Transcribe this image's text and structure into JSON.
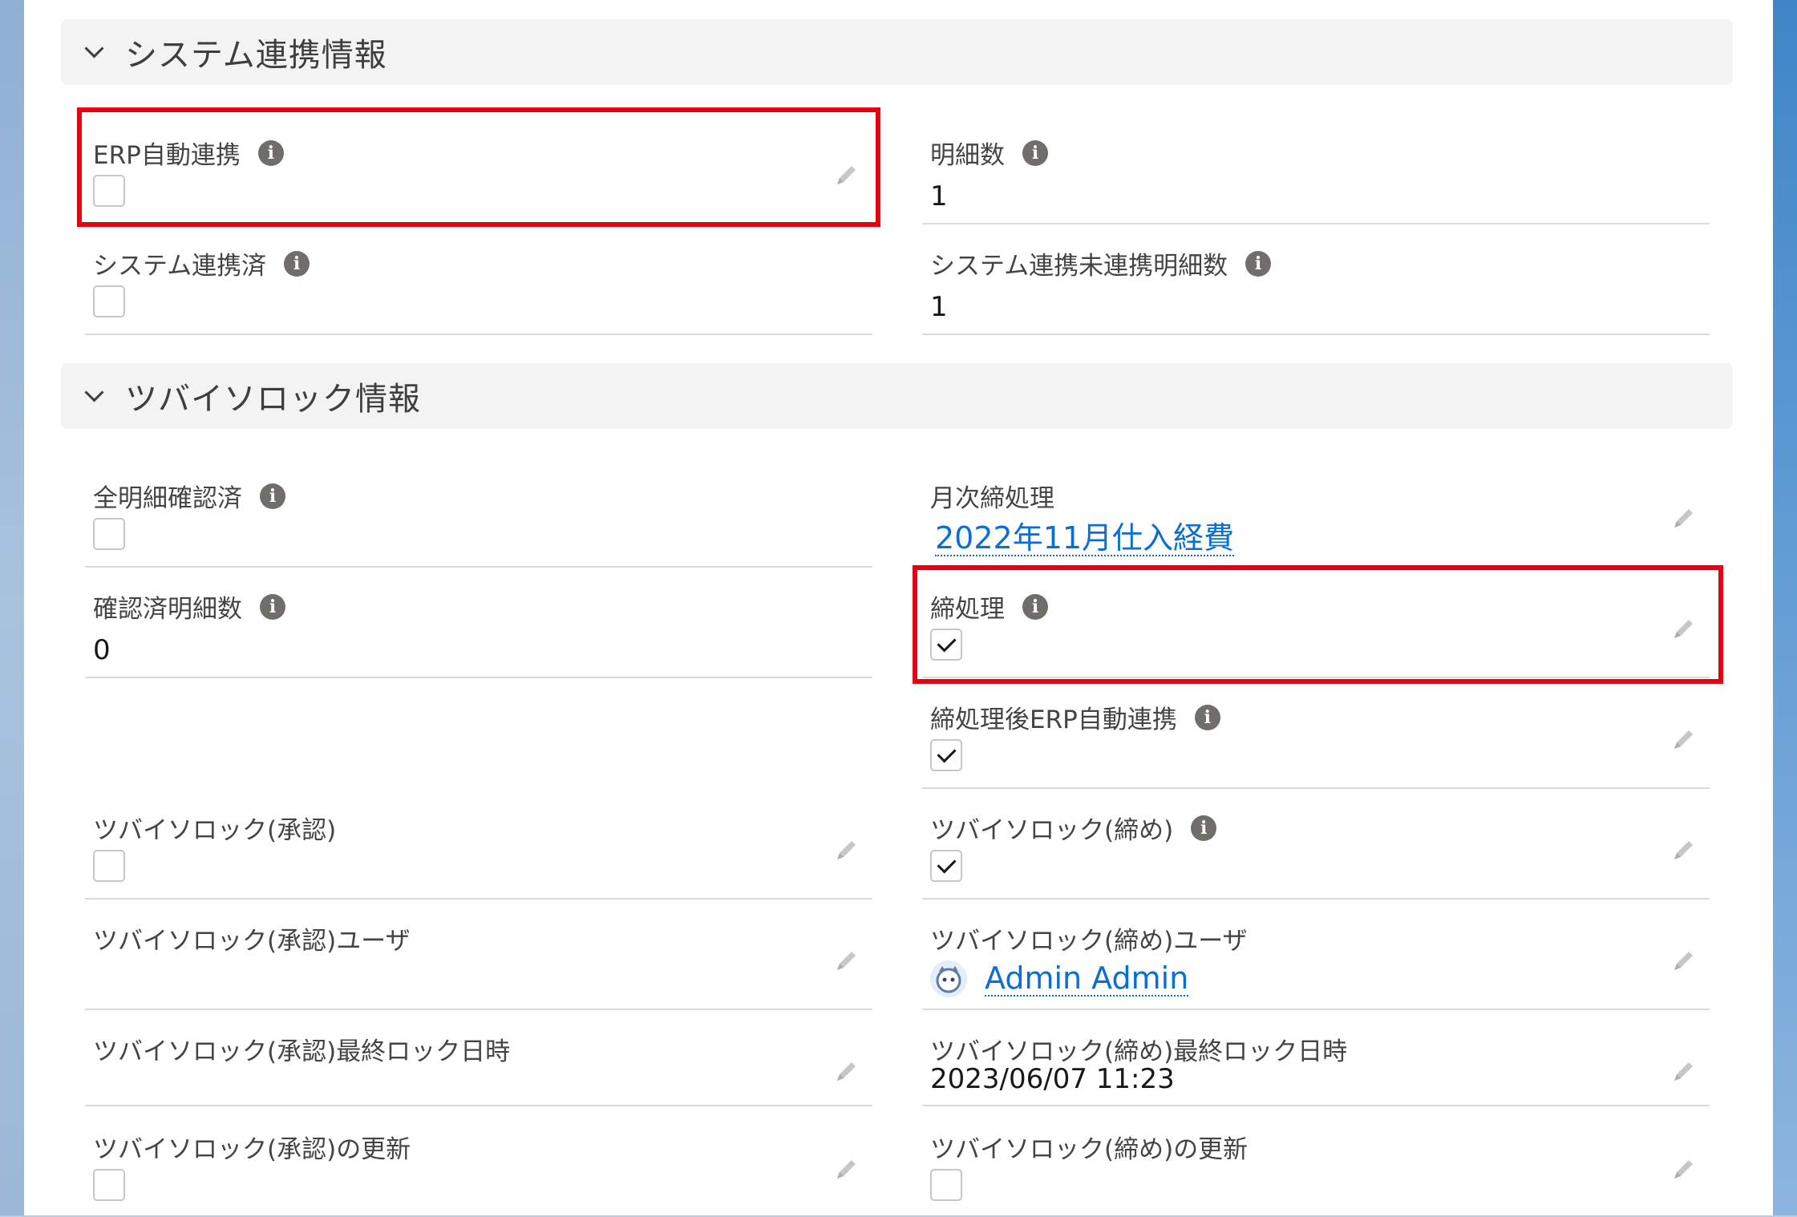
{
  "sections": {
    "system": {
      "title": "システム連携情報"
    },
    "lock": {
      "title": "ツバイソロック情報"
    }
  },
  "fields": {
    "erp_auto": {
      "label": "ERP自動連携",
      "checked": false
    },
    "line_count": {
      "label": "明細数",
      "value": "1"
    },
    "system_linked": {
      "label": "システム連携済",
      "checked": false
    },
    "unlinked_line_count": {
      "label": "システム連携未連携明細数",
      "value": "1"
    },
    "all_lines_confirmed": {
      "label": "全明細確認済",
      "checked": false
    },
    "monthly_close": {
      "label": "月次締処理",
      "value": "2022年11月仕入経費"
    },
    "confirmed_line_count": {
      "label": "確認済明細数",
      "value": "0"
    },
    "close_process": {
      "label": "締処理",
      "checked": true
    },
    "post_close_erp": {
      "label": "締処理後ERP自動連携",
      "checked": true
    },
    "lock_approval": {
      "label": "ツバイソロック(承認)",
      "checked": false
    },
    "lock_close": {
      "label": "ツバイソロック(締め)",
      "checked": true
    },
    "lock_approval_user": {
      "label": "ツバイソロック(承認)ユーザ",
      "value": ""
    },
    "lock_close_user": {
      "label": "ツバイソロック(締め)ユーザ",
      "value": "Admin Admin"
    },
    "lock_approval_last": {
      "label": "ツバイソロック(承認)最終ロック日時",
      "value": ""
    },
    "lock_close_last": {
      "label": "ツバイソロック(締め)最終ロック日時",
      "value": "2023/06/07 11:23"
    },
    "lock_approval_update": {
      "label": "ツバイソロック(承認)の更新",
      "checked": false
    },
    "lock_close_update": {
      "label": "ツバイソロック(締め)の更新",
      "checked": false
    }
  },
  "icons": {
    "info": "info-icon",
    "edit": "pencil-icon",
    "collapse": "chevron-down-icon"
  },
  "colors": {
    "highlight": "#e60012",
    "link": "#0b6ed4",
    "info_icon": "#706e6b"
  }
}
